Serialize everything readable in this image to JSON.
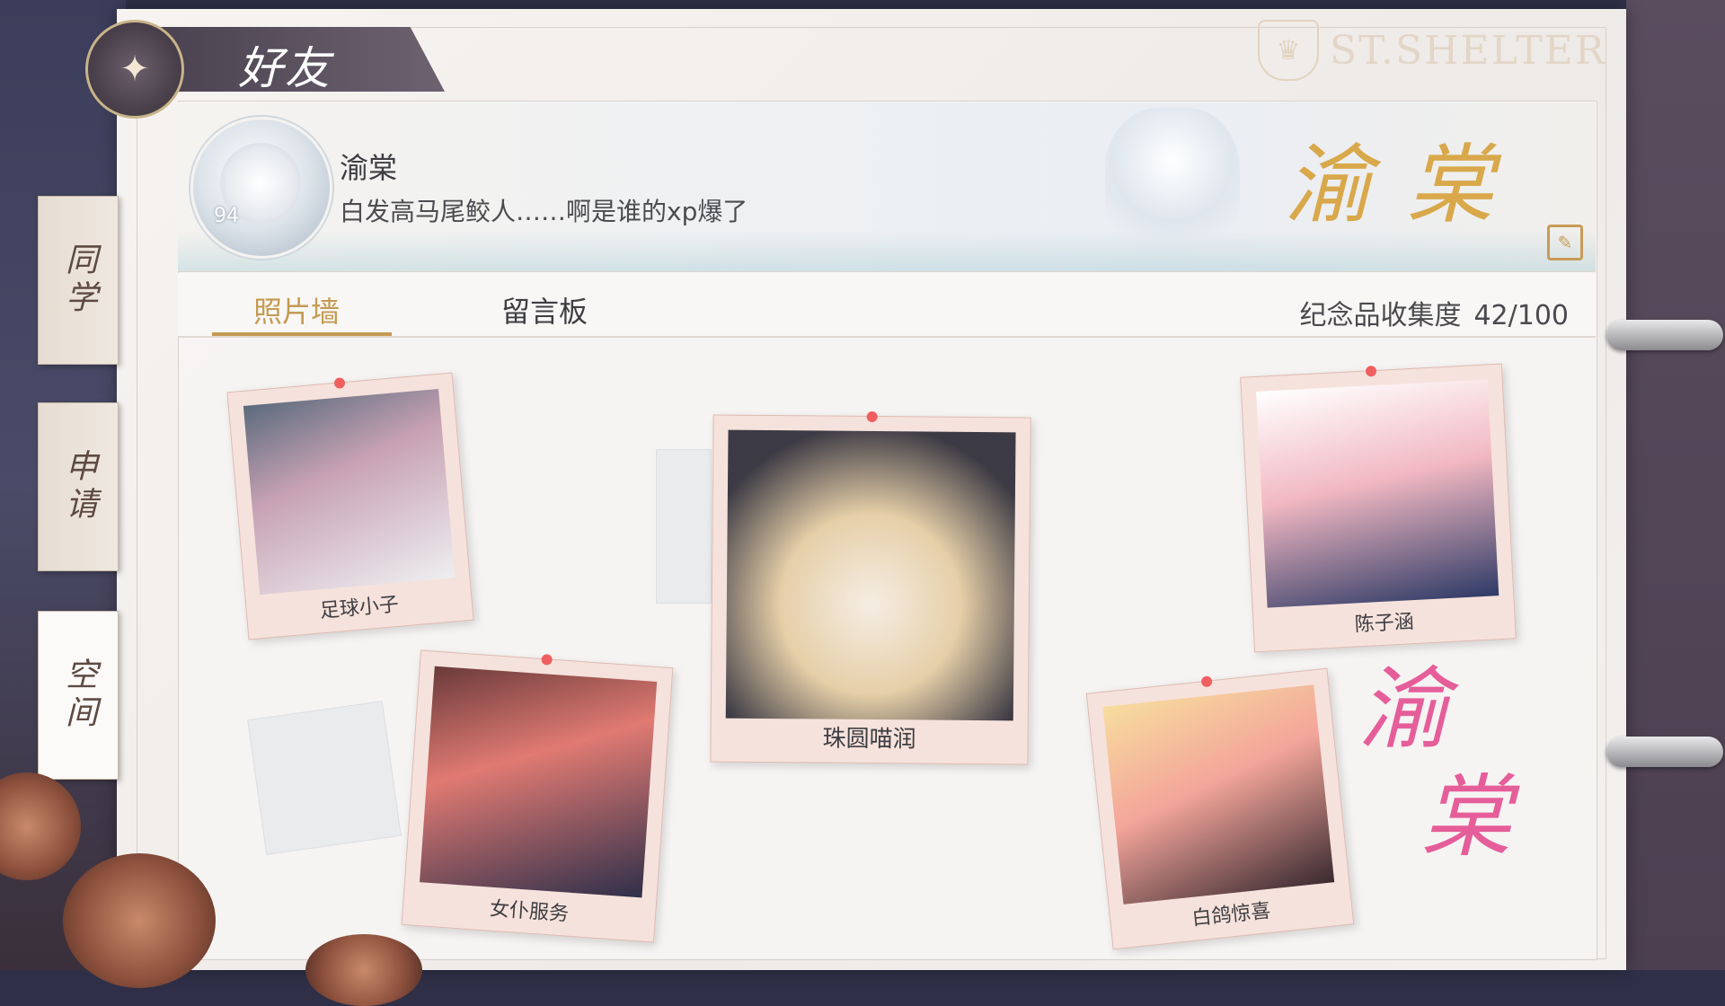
{
  "header": {
    "title": "好友",
    "emblem_icon": "butterfly-icon",
    "logo_text": "ST.SHELTER"
  },
  "side_tabs": [
    {
      "label": "同学",
      "active": false
    },
    {
      "label": "申请",
      "active": false
    },
    {
      "label": "空间",
      "active": true
    }
  ],
  "profile": {
    "name": "渝棠",
    "bio": "白发高马尾鲛人……啊是谁的xp爆了",
    "level": "94",
    "banner_text": "渝棠",
    "signature": [
      "渝",
      "棠"
    ]
  },
  "tabs": {
    "photo_wall": "照片墙",
    "message_board": "留言板",
    "active": "photo_wall"
  },
  "collection": {
    "label": "纪念品收集度",
    "value": "42/100"
  },
  "photos": [
    {
      "caption": "足球小子"
    },
    {
      "caption": "女仆服务"
    },
    {
      "caption": "珠圆喵润"
    },
    {
      "caption": "陈子涵"
    },
    {
      "caption": "白鸽惊喜"
    }
  ],
  "colors": {
    "accent_gold": "#c49a52",
    "signature_pink": "#e55e9a",
    "photo_frame": "#f6e2dc",
    "pin_red": "#ef5f5f"
  }
}
